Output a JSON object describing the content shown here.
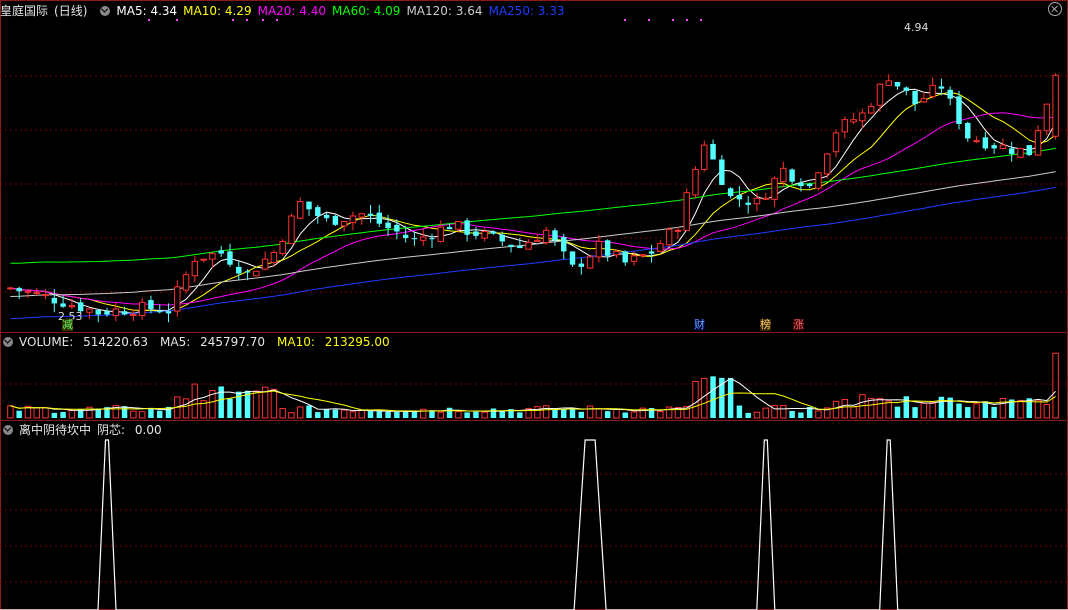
{
  "stock_name": "皇庭国际",
  "period": "(日线)",
  "price_panel": {
    "ma": [
      {
        "label": "MA5:",
        "value": "4.34",
        "color": "#ffffff"
      },
      {
        "label": "MA10:",
        "value": "4.29",
        "color": "#ffff00"
      },
      {
        "label": "MA20:",
        "value": "4.40",
        "color": "#ff00ff"
      },
      {
        "label": "MA60:",
        "value": "4.09",
        "color": "#00ff00"
      },
      {
        "label": "MA120:",
        "value": "3.64",
        "color": "#cccccc"
      },
      {
        "label": "MA250:",
        "value": "3.33",
        "color": "#1f3cff"
      }
    ],
    "high_label": "4.94",
    "low_label": "2.53",
    "event_marks": [
      {
        "text": "减",
        "color": "#66ff66",
        "bg": "#333300"
      },
      {
        "text": "财",
        "color": "#66aaff",
        "bg": "#000033"
      },
      {
        "text": "榜",
        "color": "#ffcc66",
        "bg": "#332200"
      },
      {
        "text": "涨",
        "color": "#ff6666",
        "bg": "#330000"
      }
    ]
  },
  "volume_panel": {
    "title": "VOLUME:",
    "value": "514220.63",
    "ma5_label": "MA5:",
    "ma5_value": "245797.70",
    "ma10_label": "MA10:",
    "ma10_value": "213295.00"
  },
  "indicator_panel": {
    "title": "离中阴待坎中",
    "signal_label": "阴芯:",
    "signal_value": "0.00"
  },
  "colors": {
    "up": "#ff3030",
    "down": "#54ffff",
    "grid": "#7a0000",
    "border": "#8b1a1a"
  },
  "chart_data": {
    "type": "candlestick",
    "x_count": 120,
    "ylim": [
      2.4,
      5.2
    ],
    "candles": [],
    "volumes": [],
    "signal": {
      "spikes": [
        11,
        66,
        86,
        100
      ],
      "values": [
        1,
        1,
        1,
        1
      ],
      "last_value": 0.0
    },
    "ma_values": {
      "MA5": 4.34,
      "MA10": 4.29,
      "MA20": 4.4,
      "MA60": 4.09,
      "MA120": 3.64,
      "MA250": 3.33
    },
    "volume_ma": {
      "MA5": 245797.7,
      "MA10": 213295.0
    },
    "last_volume": 514220.63,
    "high": 4.94,
    "low": 2.53
  }
}
